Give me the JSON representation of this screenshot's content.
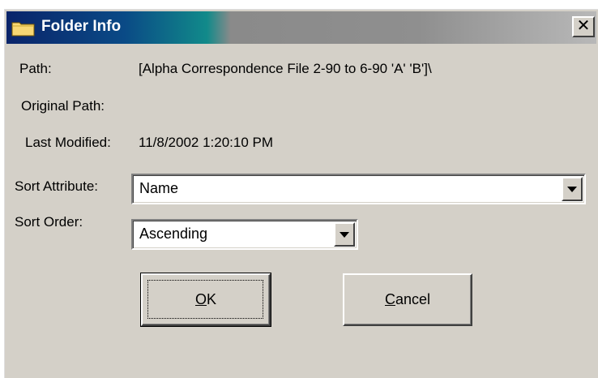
{
  "window": {
    "title": "Folder Info",
    "close_glyph": "✕",
    "icon": "folder-icon"
  },
  "info": {
    "path_label": "Path:",
    "path_value": "[Alpha Correspondence File 2-90 to 6-90 'A'  'B']\\",
    "original_path_label": "Original Path:",
    "original_path_value": "",
    "last_modified_label": "Last Modified:",
    "last_modified_value": "11/8/2002 1:20:10 PM"
  },
  "sort": {
    "attribute_label": "Sort Attribute:",
    "attribute_value": "Name",
    "order_label": "Sort Order:",
    "order_value": "Ascending"
  },
  "buttons": {
    "ok_mnemonic": "O",
    "ok_rest": "K",
    "cancel_mnemonic": "C",
    "cancel_rest": "ancel"
  },
  "colors": {
    "dialog_bg": "#d4d0c8",
    "title_active": "#0a246a",
    "title_text": "#ffffff"
  }
}
